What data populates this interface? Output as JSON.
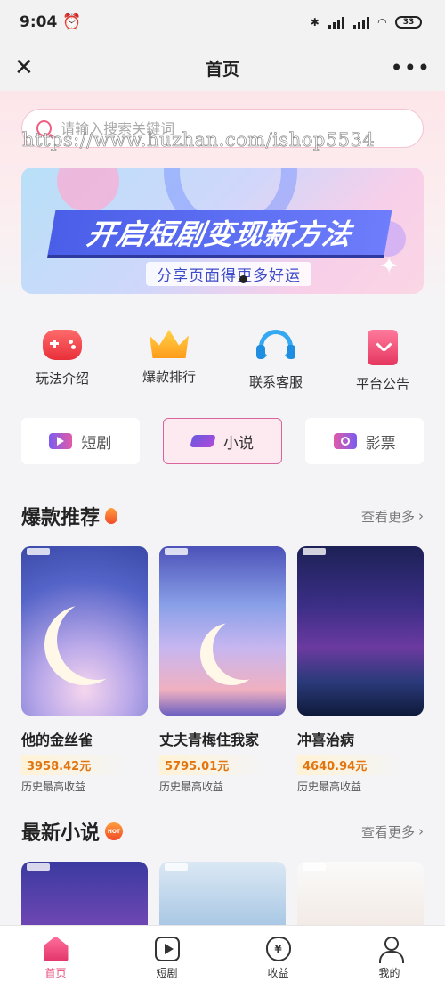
{
  "status": {
    "time": "9:04",
    "battery": "33"
  },
  "header": {
    "title": "首页",
    "close_icon": "close-icon",
    "more_icon": "more-icon"
  },
  "search": {
    "placeholder": "请输入搜索关键词",
    "watermark": "https://www.huzhan.com/ishop5534"
  },
  "banner": {
    "headline": "开启短剧变现新方法",
    "subline": "分享页面得更多好运"
  },
  "quick_links": [
    {
      "label": "玩法介绍",
      "icon": "gamepad-icon"
    },
    {
      "label": "爆款排行",
      "icon": "crown-icon"
    },
    {
      "label": "联系客服",
      "icon": "headset-icon"
    },
    {
      "label": "平台公告",
      "icon": "notice-icon"
    }
  ],
  "categories": [
    {
      "label": "短剧",
      "icon": "video-icon",
      "active": false
    },
    {
      "label": "小说",
      "icon": "book-icon",
      "active": true
    },
    {
      "label": "影票",
      "icon": "ticket-icon",
      "active": false
    }
  ],
  "hot": {
    "title": "爆款推荐",
    "more": "查看更多",
    "items": [
      {
        "name": "他的金丝雀",
        "amount": "3958.42元",
        "caption": "历史最高收益"
      },
      {
        "name": "丈夫青梅住我家",
        "amount": "5795.01元",
        "caption": "历史最高收益"
      },
      {
        "name": "冲喜治病",
        "amount": "4640.94元",
        "caption": "历史最高收益"
      }
    ]
  },
  "newest": {
    "title": "最新小说",
    "badge": "HOT",
    "more": "查看更多"
  },
  "tabbar": [
    {
      "label": "首页",
      "icon": "home-icon",
      "active": true
    },
    {
      "label": "短剧",
      "icon": "play-icon",
      "active": false
    },
    {
      "label": "收益",
      "icon": "money-bag-icon",
      "active": false
    },
    {
      "label": "我的",
      "icon": "user-icon",
      "active": false
    }
  ],
  "colors": {
    "accent": "#e64a7a",
    "amount": "#e2750f"
  }
}
